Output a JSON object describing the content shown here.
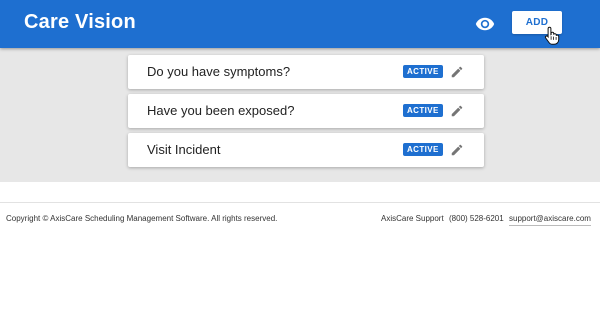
{
  "header": {
    "title": "Care Vision",
    "icon": "eye-icon",
    "add_label": "ADD",
    "brand_color": "#1e6fd0"
  },
  "cards": [
    {
      "title": "Do you have symptoms?",
      "status": "ACTIVE",
      "icon": "edit-icon"
    },
    {
      "title": "Have you been exposed?",
      "status": "ACTIVE",
      "icon": "edit-icon"
    },
    {
      "title": "Visit Incident",
      "status": "ACTIVE",
      "icon": "edit-icon"
    }
  ],
  "footer": {
    "copyright": "Copyright © AxisCare Scheduling Management Software. All rights reserved.",
    "support_label": "AxisCare Support",
    "phone": "(800) 528-6201",
    "email": "support@axiscare.com"
  }
}
